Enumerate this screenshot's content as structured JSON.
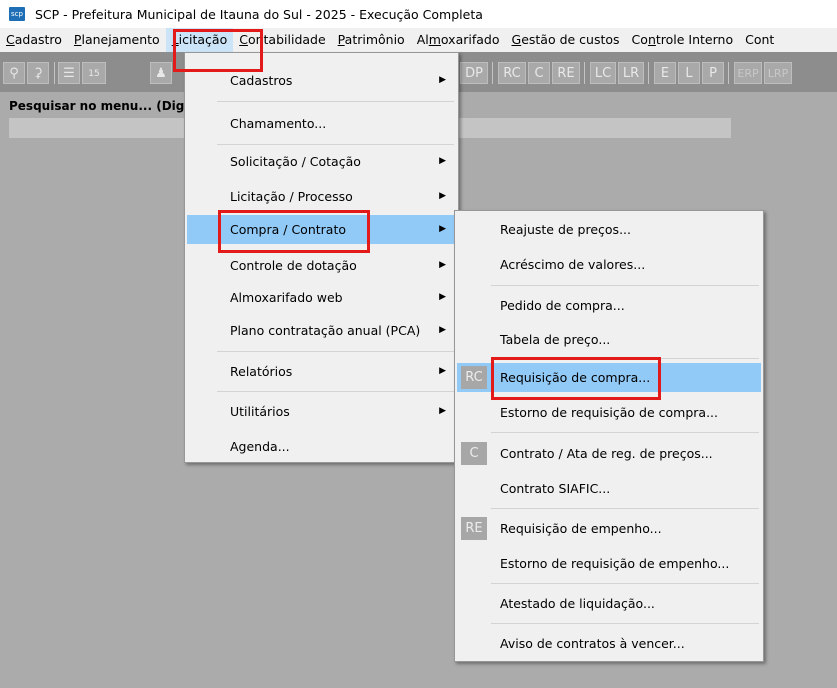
{
  "window": {
    "icon_text": "scp",
    "title": "SCP - Prefeitura Municipal de Itauna do Sul - 2025 - Execução Completa"
  },
  "menubar": {
    "items": [
      {
        "pre": "",
        "u": "C",
        "post": "adastro"
      },
      {
        "pre": "",
        "u": "P",
        "post": "lanejamento"
      },
      {
        "pre": "",
        "u": "L",
        "post": "icitação"
      },
      {
        "pre": "",
        "u": "C",
        "post": "ontabilidade"
      },
      {
        "pre": "",
        "u": "P",
        "post": "atrimônio"
      },
      {
        "pre": "Al",
        "u": "m",
        "post": "oxarifado"
      },
      {
        "pre": "",
        "u": "G",
        "post": "estão de custos"
      },
      {
        "pre": "Co",
        "u": "n",
        "post": "trole Interno"
      },
      {
        "pre": "Cont",
        "u": "",
        "post": ""
      }
    ]
  },
  "toolbar": {
    "buttons": [
      "DP",
      "RC",
      "C",
      "RE",
      "LC",
      "LR",
      "E",
      "L",
      "P",
      "ERP",
      "LRP"
    ]
  },
  "search": {
    "label": "Pesquisar no menu... (Dig",
    "value": ""
  },
  "licitacao_menu": {
    "items": [
      {
        "label": "Cadastros"
      },
      {
        "label": "Chamamento..."
      },
      {
        "label": "Solicitação / Cotação"
      },
      {
        "label": "Licitação / Processo"
      },
      {
        "label": "Compra / Contrato"
      },
      {
        "label": "Controle de dotação"
      },
      {
        "label": "Almoxarifado web"
      },
      {
        "label": "Plano contratação anual (PCA)"
      },
      {
        "label": "Relatórios"
      },
      {
        "label": "Utilitários"
      },
      {
        "label": "Agenda..."
      }
    ]
  },
  "compra_submenu": {
    "items": [
      {
        "label": "Reajuste de preços..."
      },
      {
        "label": "Acréscimo de valores..."
      },
      {
        "label": "Pedido de compra..."
      },
      {
        "label": "Tabela de preço..."
      },
      {
        "label": "Requisição de compra...",
        "icon": "RC"
      },
      {
        "label": "Estorno de requisição de compra..."
      },
      {
        "label": "Contrato / Ata de reg. de preços...",
        "icon": "C"
      },
      {
        "label": "Contrato SIAFIC..."
      },
      {
        "label": "Requisição de empenho...",
        "icon": "RE"
      },
      {
        "label": "Estorno de requisição de empenho..."
      },
      {
        "label": "Atestado de liquidação..."
      },
      {
        "label": "Aviso de contratos à vencer..."
      }
    ]
  },
  "colors": {
    "highlight": "#91c9f7",
    "annotation_red": "#e21a1a",
    "workspace": "#ababab"
  }
}
